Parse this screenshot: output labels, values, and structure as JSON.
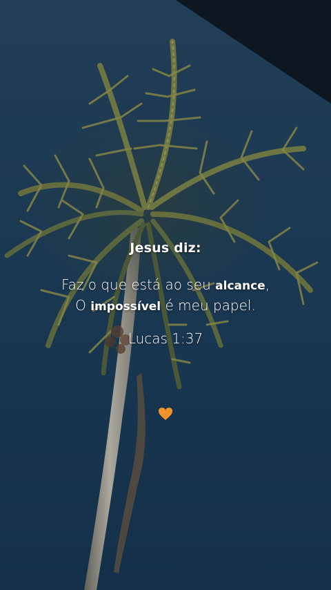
{
  "quote": {
    "heading": "Jesus diz:",
    "line1_before": "Faz o que está ao seu ",
    "line1_bold": "alcance",
    "line1_after": ",",
    "line2_before": "O ",
    "line2_bold": "impossível",
    "line2_after": " é meu papel.",
    "reference": "Lucas 1:37"
  },
  "decoration": {
    "heart_icon": "orange-heart-icon",
    "heart_color": "#f0932b"
  },
  "colors": {
    "sky_top": "#27455f",
    "sky_bottom": "#1a3a57",
    "text": "#ffffff",
    "palm_frond": "#a7a24f",
    "trunk": "#cfc7b6"
  }
}
